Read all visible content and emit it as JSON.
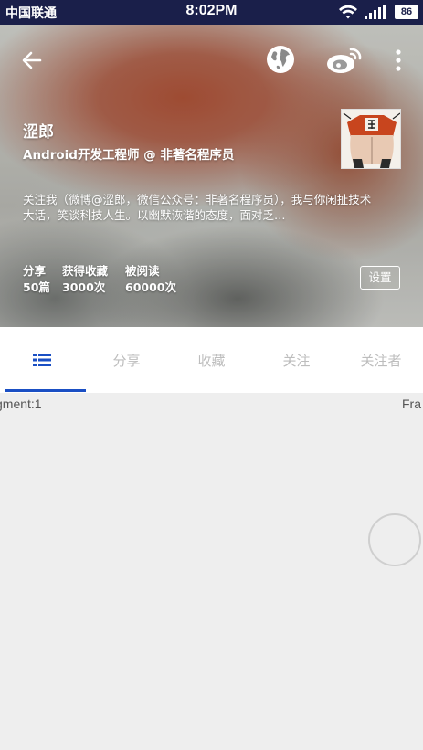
{
  "status_bar": {
    "carrier": "中国联通",
    "time": "8:02PM",
    "battery": "86"
  },
  "header": {
    "name": "涩郎",
    "title": "Android开发工程师 @ 非著名程序员",
    "bio": "关注我（微博@涩郎，微信公众号：非著名程序员），我与你闲扯技术大话，笑谈科技人生。以幽默诙谐的态度，面对乏…",
    "stats": [
      {
        "label": "分享",
        "value": "50篇"
      },
      {
        "label": "获得收藏",
        "value": "3000次"
      },
      {
        "label": "被阅读",
        "value": "60000次"
      }
    ],
    "settings_label": "设置"
  },
  "tabs": [
    {
      "label": "",
      "icon": "list-icon",
      "active": true
    },
    {
      "label": "分享"
    },
    {
      "label": "收藏"
    },
    {
      "label": "关注"
    },
    {
      "label": "关注者"
    }
  ],
  "content": {
    "left_text": "gment:1",
    "right_text": "Fra"
  },
  "colors": {
    "status_bar": "#1a1f4a",
    "accent": "#1a4fc4",
    "inactive_tab": "#bdbdbd",
    "content_bg": "#eeeeee"
  }
}
